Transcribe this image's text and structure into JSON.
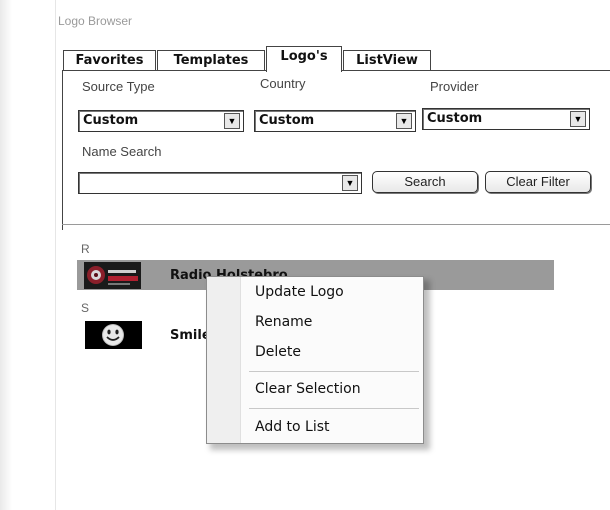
{
  "window": {
    "title": "Logo Browser"
  },
  "tabs": [
    {
      "label": "Favorites",
      "active": false
    },
    {
      "label": "Templates",
      "active": false
    },
    {
      "label": "Logo's",
      "active": true
    },
    {
      "label": "ListView",
      "active": false
    }
  ],
  "filters": {
    "source_type": {
      "label": "Source Type",
      "value": "Custom"
    },
    "country": {
      "label": "Country",
      "value": "Custom"
    },
    "provider": {
      "label": "Provider",
      "value": "Custom"
    },
    "name_search": {
      "label": "Name Search",
      "value": ""
    }
  },
  "buttons": {
    "search": "Search",
    "clear_filter": "Clear Filter"
  },
  "groups": [
    {
      "letter": "R",
      "item": {
        "name": "Radio Holstebro",
        "logo_icon": "radio-holstebro-logo",
        "selected": true
      }
    },
    {
      "letter": "S",
      "item": {
        "name": "Smile",
        "logo_icon": "smiley-face-logo",
        "selected": false
      }
    }
  ],
  "context_menu": {
    "items": [
      "Update Logo",
      "Rename",
      "Delete",
      "Clear Selection",
      "Add to List"
    ]
  },
  "colors": {
    "selection": "#9a9a9a",
    "menu_bg": "#fbfbfb"
  }
}
